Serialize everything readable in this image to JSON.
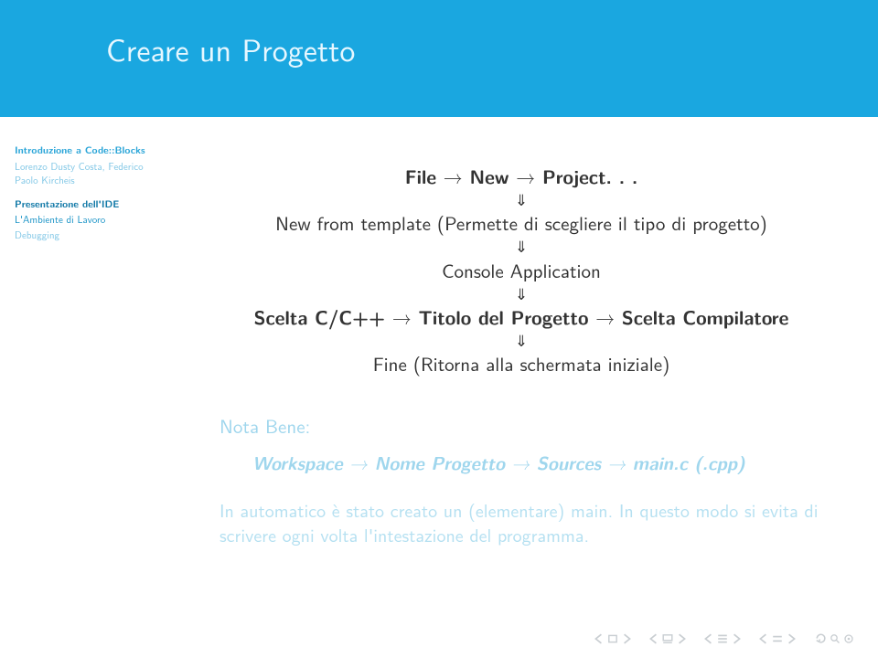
{
  "slide": {
    "title": "Creare un Progetto"
  },
  "sidebar": {
    "section1": {
      "title": "Introduzione a Code::Blocks",
      "authors": "Lorenzo Dusty Costa, Federico Paolo Kircheis"
    },
    "section2": {
      "title": "Presentazione dell'IDE"
    },
    "section3": {
      "title": "L'Ambiente di Lavoro"
    },
    "section4": {
      "title": "Debugging"
    }
  },
  "content": {
    "line1_a": "File ",
    "line1_b": " New ",
    "line1_c": " Project. . .",
    "line2": "New from template (Permette di scegliere il tipo di progetto)",
    "line3": "Console Application",
    "line4_a": "Scelta C/C++ ",
    "line4_b": " Titolo del Progetto ",
    "line4_c": " Scelta Compilatore",
    "line5": "Fine (Ritorna alla schermata iniziale)"
  },
  "ghost1": {
    "title": "Nota Bene:",
    "body_a": "Workspace ",
    "body_b": " Nome Progetto ",
    "body_c": " Sources ",
    "body_d": " main.c (.cpp)"
  },
  "ghost2": {
    "text": "In automatico è stato creato un (elementare) main. In questo modo si evita di scrivere ogni volta l'intestazione del programma."
  },
  "icons": {
    "right_arrow": "→",
    "double_down": "⇓"
  }
}
